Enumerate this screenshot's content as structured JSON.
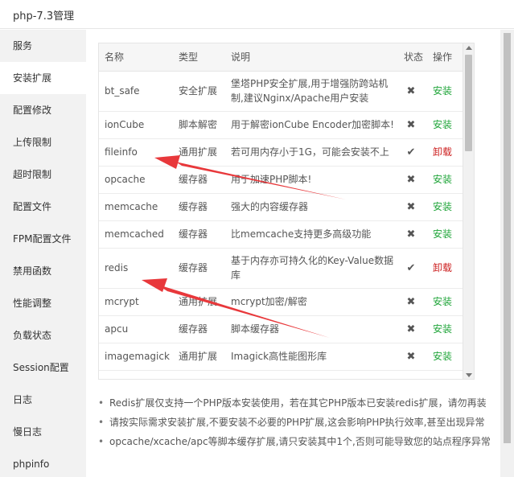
{
  "window": {
    "title": "php-7.3管理"
  },
  "sidebar": {
    "items": [
      {
        "label": "服务"
      },
      {
        "label": "安装扩展"
      },
      {
        "label": "配置修改"
      },
      {
        "label": "上传限制"
      },
      {
        "label": "超时限制"
      },
      {
        "label": "配置文件"
      },
      {
        "label": "FPM配置文件"
      },
      {
        "label": "禁用函数"
      },
      {
        "label": "性能调整"
      },
      {
        "label": "负载状态"
      },
      {
        "label": "Session配置"
      },
      {
        "label": "日志"
      },
      {
        "label": "慢日志"
      },
      {
        "label": "phpinfo"
      }
    ],
    "active_index": 1
  },
  "table": {
    "columns": {
      "name": "名称",
      "type": "类型",
      "desc": "说明",
      "status": "状态",
      "action": "操作"
    },
    "rows": [
      {
        "name": "bt_safe",
        "type": "安全扩展",
        "desc": "堡塔PHP安全扩展,用于增强防跨站机制,建议Nginx/Apache用户安装",
        "status": "not-installed",
        "action": "安装"
      },
      {
        "name": "ionCube",
        "type": "脚本解密",
        "desc": "用于解密ionCube Encoder加密脚本!",
        "status": "not-installed",
        "action": "安装"
      },
      {
        "name": "fileinfo",
        "type": "通用扩展",
        "desc": "若可用内存小于1G，可能会安装不上",
        "status": "installed",
        "action": "卸载"
      },
      {
        "name": "opcache",
        "type": "缓存器",
        "desc": "用于加速PHP脚本!",
        "status": "not-installed",
        "action": "安装"
      },
      {
        "name": "memcache",
        "type": "缓存器",
        "desc": "强大的内容缓存器",
        "status": "not-installed",
        "action": "安装"
      },
      {
        "name": "memcached",
        "type": "缓存器",
        "desc": "比memcache支持更多高级功能",
        "status": "not-installed",
        "action": "安装"
      },
      {
        "name": "redis",
        "type": "缓存器",
        "desc": "基于内存亦可持久化的Key-Value数据库",
        "status": "installed",
        "action": "卸载"
      },
      {
        "name": "mcrypt",
        "type": "通用扩展",
        "desc": "mcrypt加密/解密",
        "status": "not-installed",
        "action": "安装"
      },
      {
        "name": "apcu",
        "type": "缓存器",
        "desc": "脚本缓存器",
        "status": "not-installed",
        "action": "安装"
      },
      {
        "name": "imagemagick",
        "type": "通用扩展",
        "desc": "Imagick高性能图形库",
        "status": "not-installed",
        "action": "安装"
      }
    ]
  },
  "notes": [
    "Redis扩展仅支持一个PHP版本安装使用，若在其它PHP版本已安装redis扩展，请勿再装",
    "请按实际需求安装扩展,不要安装不必要的PHP扩展,这会影响PHP执行效率,甚至出现异常",
    "opcache/xcache/apc等脚本缓存扩展,请只安装其中1个,否则可能导致您的站点程序异常"
  ],
  "icons": {
    "not-installed": "close-icon",
    "installed": "check-icon"
  },
  "colors": {
    "install": "#20a53a",
    "uninstall": "#cc1f1f",
    "annotation_arrow": "#e8383b"
  }
}
